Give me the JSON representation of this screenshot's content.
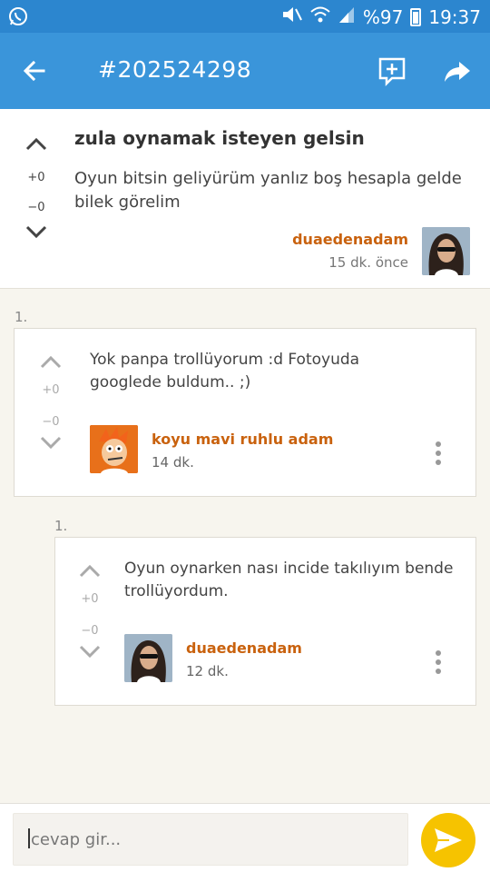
{
  "status_bar": {
    "battery_text": "%97",
    "time": "19:37"
  },
  "app_bar": {
    "title": "#202524298"
  },
  "post": {
    "title": "zula oynamak isteyen gelsin",
    "body": "Oyun bitsin geliyürüm yanlız boş hesapla gelde bilek görelim",
    "upvotes": "+0",
    "downvotes": "−0",
    "author": "duaedenadam",
    "time": "15 dk. önce"
  },
  "comments": [
    {
      "number": "1.",
      "text": "Yok panpa trollüyorum :d Fotoyuda googlede buldum.. ;)",
      "upvotes": "+0",
      "downvotes": "−0",
      "author": "koyu mavi ruhlu adam",
      "time": "14 dk."
    },
    {
      "number": "1.",
      "text": "Oyun oynarken nası incide takılıyım bende trollüyordum.",
      "upvotes": "+0",
      "downvotes": "−0",
      "author": "duaedenadam",
      "time": "12 dk."
    }
  ],
  "reply": {
    "placeholder": "cevap gir..."
  },
  "colors": {
    "status_bar": "#2c86cf",
    "app_bar": "#3a95da",
    "author": "#c9620e",
    "send_button": "#f6c300"
  },
  "icons": {
    "status_left": "whatsapp-icon",
    "back": "arrow-back-icon",
    "compose": "add-comment-icon",
    "share": "share-arrow-icon",
    "send": "send-icon",
    "more": "more-vertical-icon"
  }
}
